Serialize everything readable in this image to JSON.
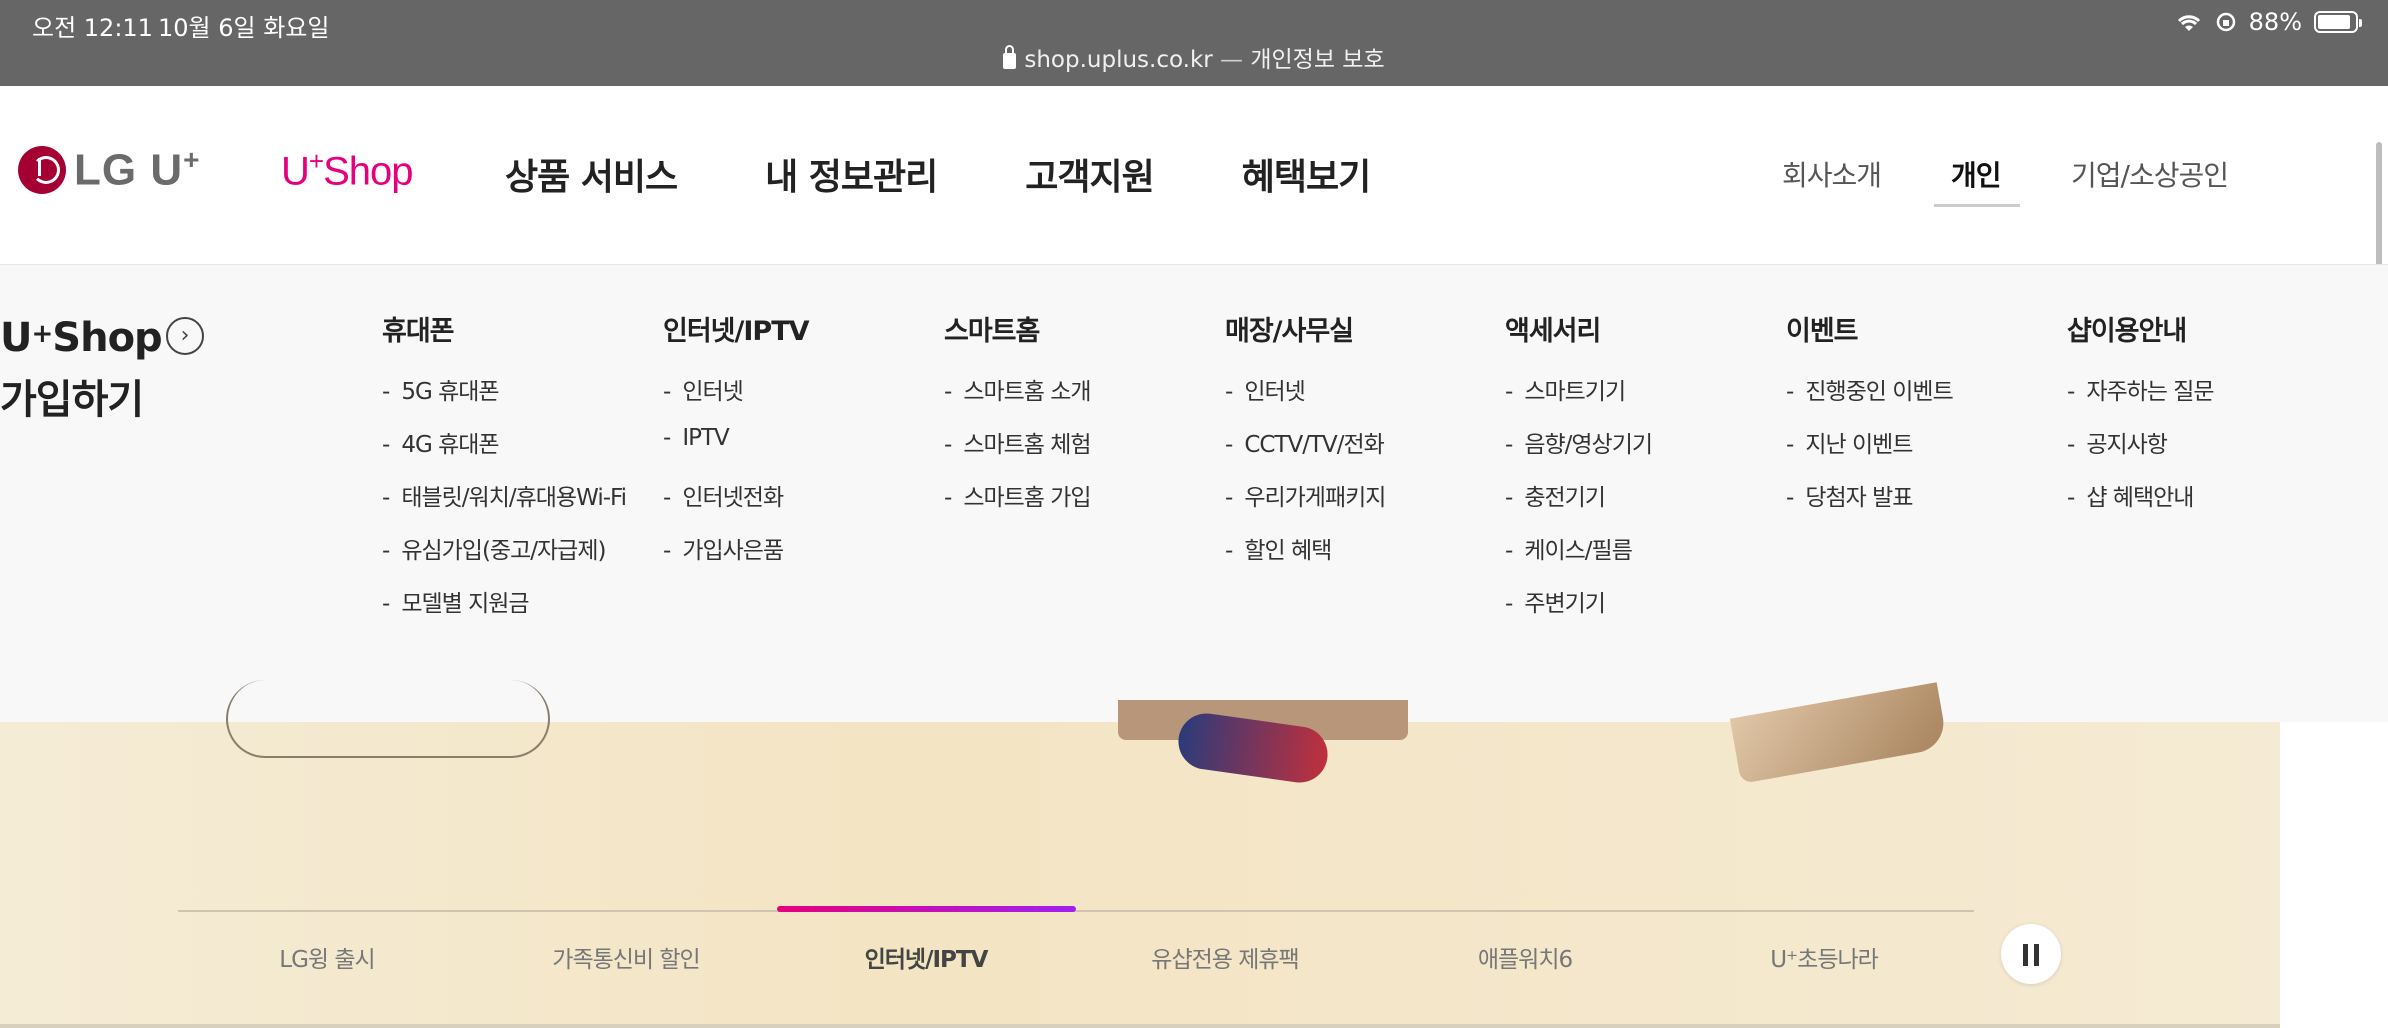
{
  "status_bar": {
    "time": "오전 12:11",
    "date": "10월 6일 화요일",
    "url_host": "shop.uplus.co.kr",
    "url_note": "개인정보 보호",
    "battery": "88%",
    "battery_level": 0.88
  },
  "header": {
    "logo_text": "LG U",
    "logo_sup": "+",
    "shop_prefix": "U",
    "shop_sup": "+",
    "shop_name": "Shop",
    "gnb": [
      "상품 서비스",
      "내 정보관리",
      "고객지원",
      "혜택보기"
    ],
    "util": {
      "company": "회사소개",
      "personal": "개인",
      "business": "기업/소상공인"
    }
  },
  "mega_menu": {
    "title_prefix": "U",
    "title_sup": "+",
    "title_shop": "Shop",
    "title_line2": "가입하기",
    "columns": [
      {
        "heading": "휴대폰",
        "items": [
          "5G 휴대폰",
          "4G 휴대폰",
          "태블릿/워치/휴대용Wi-Fi",
          "유심가입(중고/자급제)",
          "모델별 지원금"
        ]
      },
      {
        "heading": "인터넷/IPTV",
        "items": [
          "인터넷",
          "IPTV",
          "인터넷전화",
          "가입사은품"
        ]
      },
      {
        "heading": "스마트홈",
        "items": [
          "스마트홈 소개",
          "스마트홈 체험",
          "스마트홈 가입"
        ]
      },
      {
        "heading": "매장/사무실",
        "items": [
          "인터넷",
          "CCTV/TV/전화",
          "우리가게패키지",
          "할인 혜택"
        ]
      },
      {
        "heading": "액세서리",
        "items": [
          "스마트기기",
          "음향/영상기기",
          "충전기기",
          "케이스/필름",
          "주변기기"
        ]
      },
      {
        "heading": "이벤트",
        "items": [
          "진행중인 이벤트",
          "지난 이벤트",
          "당첨자 발표"
        ]
      },
      {
        "heading": "샵이용안내",
        "items": [
          "자주하는 질문",
          "공지사항",
          "샵 혜택안내"
        ]
      }
    ]
  },
  "banner": {
    "tabs": [
      "LG윙 출시",
      "가족통신비 할인",
      "인터넷/IPTV",
      "유샵전용 제휴팩",
      "애플워치6",
      "U⁺초등나라"
    ],
    "active_tab_index": 2
  },
  "colors": {
    "brand": "#e6007e",
    "lg_red": "#a50034",
    "status_bar": "#666666"
  }
}
